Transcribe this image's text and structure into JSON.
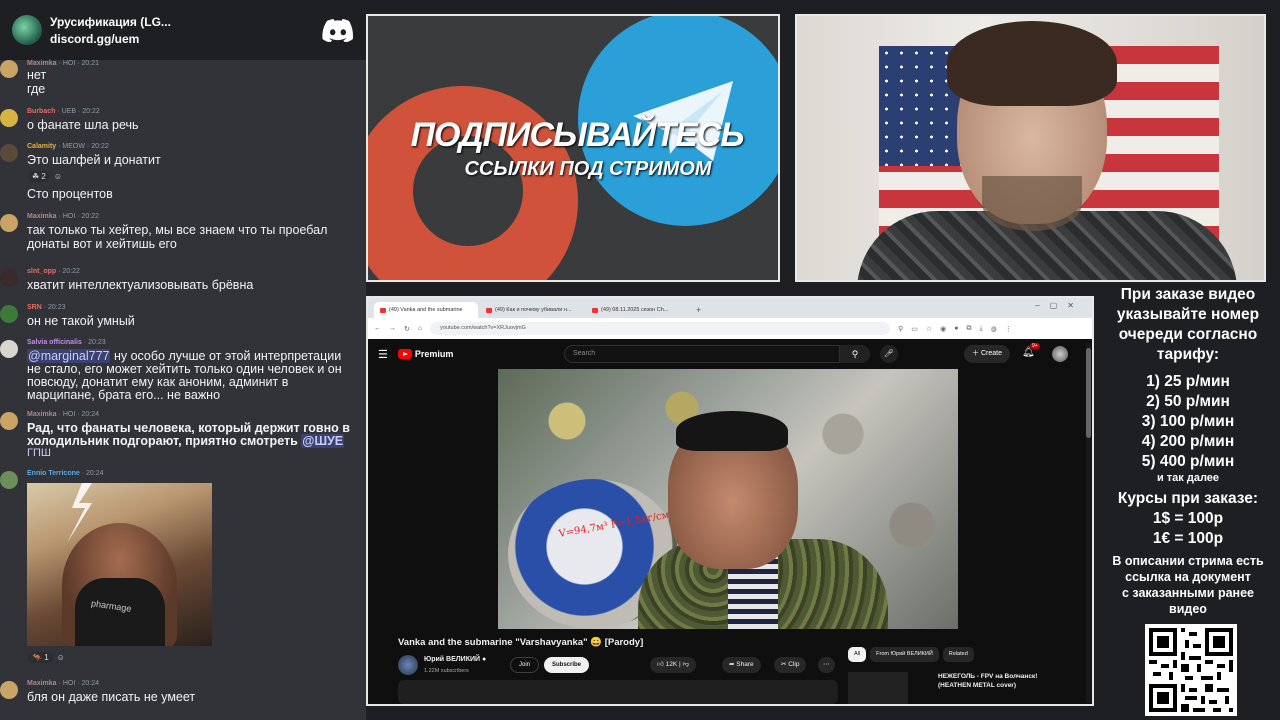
{
  "chat": {
    "server_name": "Урусификация (LG...",
    "server_link": "discord.gg/uem",
    "messages": [
      {
        "user": "Maximka",
        "badge": "HOI",
        "time": "20:21",
        "color": "#b1878f",
        "lines": [
          "нет",
          "где"
        ]
      },
      {
        "user": "Burbach",
        "badge": "UEB",
        "time": "20:22",
        "color": "#e86b6b",
        "lines": [
          "о фанате шла речь"
        ]
      },
      {
        "user": "Calamity",
        "badge": "MEOW",
        "time": "20:22",
        "color": "#e8b14b",
        "lines": [
          "Это шалфей и донатит"
        ],
        "reaction": "2"
      },
      {
        "user": "",
        "badge": "",
        "time": "",
        "color": "#949ba4",
        "lines": [
          "Сто процентов"
        ]
      },
      {
        "user": "Maximka",
        "badge": "HOI",
        "time": "20:22",
        "color": "#b1878f",
        "lines": [
          "так только ты хейтер, мы все знаем что ты проебал",
          "донаты вот и хейтишь его"
        ]
      },
      {
        "user": "slnt_opp",
        "badge": "",
        "time": "20:22",
        "color": "#e86b6b",
        "lines": [
          "хватит интеллектуализовывать брёвна"
        ]
      },
      {
        "user": "SRN",
        "badge": "",
        "time": "20:23",
        "color": "#e86b6b",
        "lines": [
          "он не такой умный"
        ]
      },
      {
        "user": "Salvia officinalis",
        "badge": "",
        "time": "20:23",
        "color": "#c48cf0",
        "mention": "@marginal777",
        "lines": [
          " ну особо лучше от этой интерпретации",
          "не стало, его может хейтить только один человек и он",
          "повсюду, донатит ему как аноним, админит в",
          "марципане, брата его... не важно"
        ]
      },
      {
        "user": "Maximka",
        "badge": "HOI",
        "time": "20:24",
        "color": "#b1878f",
        "lines": [
          "Рад, что фанаты человека, который держит говно в",
          "холодильник подгорают, приятно смотреть"
        ],
        "trailing_mention": "@ШУЕ",
        "trailing_mention2": "ГПШ"
      },
      {
        "user": "Ennio Terricone",
        "badge": "",
        "time": "20:24",
        "color": "#5aa9e6",
        "gif_text": "pharmage",
        "reaction": "1"
      },
      {
        "user": "Maximka",
        "badge": "HOI",
        "time": "20:24",
        "color": "#b1878f",
        "lines": [
          "бля он даже писать не умеет"
        ]
      }
    ]
  },
  "banner": {
    "title": "ПОДПИСЫВАЙТЕСЬ",
    "subtitle": "ССЫЛКИ ПОД СТРИМОМ"
  },
  "browser": {
    "tabs": [
      "(49) Vanka and the submarine",
      "(49) Как и почему убивали н...",
      "(49) 08.11.2025 сезон Ch..."
    ],
    "url": "youtube.com/watch?v=XRJuovjmG",
    "yt_brand": "Premium",
    "search_placeholder": "Search",
    "create_label": "Create",
    "bell_count": "9+",
    "video_label": "V=94,7м³  P=1,5кг/см²",
    "video_title": "Vanka and the submarine \"Varshavyanka\" 😀 [Parody]",
    "channel_name": "Юрий ВЕЛИКИЙ",
    "subscribers": "1.22M subscribers",
    "join_label": "Join",
    "subscribe_label": "Subscribe",
    "likes": "12K",
    "share_label": "Share",
    "clip_label": "Clip",
    "chips": [
      "All",
      "From Юрий ВЕЛИКИЙ",
      "Related"
    ],
    "rec_title": "НЕЖЕГОЛЬ - FPV на Волчанск! (HEATHEN METAL cover)"
  },
  "info": {
    "lines": [
      "При заказе видео",
      "указывайте номер",
      "очереди согласно",
      "тарифу:"
    ],
    "rates": [
      "1) 25 р/мин",
      "2) 50 р/мин",
      "3) 100 р/мин",
      "4) 200 р/мин",
      "5) 400 р/мин"
    ],
    "etc": "и так далее",
    "courses_title": "Курсы при заказе:",
    "courses": [
      "1$ = 100р",
      "1€ = 100р"
    ],
    "desc_lines": [
      "В описании стрима есть",
      "ссылка на документ",
      "с заказанными ранее",
      "видео"
    ]
  },
  "colors": {
    "discord_bg": "#313338",
    "accent_blue": "#2a9fd8",
    "accent_orange": "#d0523a",
    "yt_red": "#ff0000"
  }
}
